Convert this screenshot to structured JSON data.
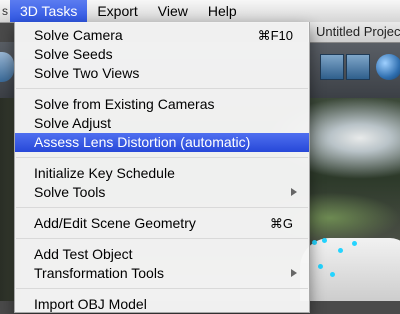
{
  "menubar": {
    "apple_stub": "s",
    "items": [
      {
        "label": "3D Tasks",
        "active": true
      },
      {
        "label": "Export",
        "active": false
      },
      {
        "label": "View",
        "active": false
      },
      {
        "label": "Help",
        "active": false
      }
    ]
  },
  "window_title": "Untitled Project",
  "dropdown": {
    "items": [
      {
        "label": "Solve Camera",
        "shortcut": "⌘F10"
      },
      {
        "label": "Solve Seeds"
      },
      {
        "label": "Solve Two Views"
      },
      {
        "label": "Solve from Existing Cameras"
      },
      {
        "label": "Solve Adjust"
      },
      {
        "label": "Assess Lens Distortion (automatic)",
        "highlighted": true
      },
      {
        "label": "Initialize Key Schedule"
      },
      {
        "label": "Solve Tools",
        "submenu": true
      },
      {
        "label": "Add/Edit Scene Geometry",
        "shortcut": "⌘G"
      },
      {
        "label": "Add Test Object"
      },
      {
        "label": "Transformation Tools",
        "submenu": true
      },
      {
        "label": "Import OBJ Model"
      }
    ]
  },
  "colors": {
    "highlight": "#2f56e3",
    "menu_bg": "#f6f6f6",
    "track_dots": "#24d4ff"
  }
}
